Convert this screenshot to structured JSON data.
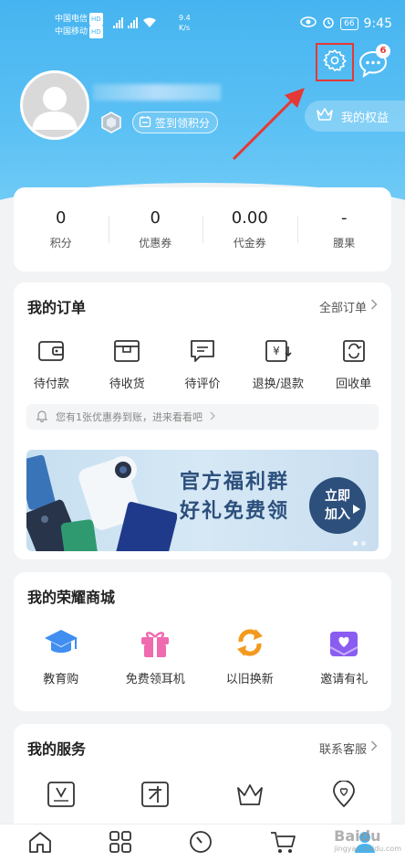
{
  "status": {
    "carrier1": "中国电信",
    "carrier2": "中国移动",
    "hd": "HD",
    "speed_value": "9.4",
    "speed_unit": "K/s",
    "battery": "66",
    "time": "9:45"
  },
  "header": {
    "message_badge": "6",
    "checkin_label": "签到领积分",
    "rights_label": "我的权益"
  },
  "stats": [
    {
      "value": "0",
      "label": "积分"
    },
    {
      "value": "0",
      "label": "优惠券"
    },
    {
      "value": "0.00",
      "label": "代金券"
    },
    {
      "value": "-",
      "label": "腰果"
    }
  ],
  "orders": {
    "title": "我的订单",
    "all_label": "全部订单",
    "items": [
      {
        "label": "待付款",
        "icon": "wallet-icon"
      },
      {
        "label": "待收货",
        "icon": "package-icon"
      },
      {
        "label": "待评价",
        "icon": "comment-icon"
      },
      {
        "label": "退换/退款",
        "icon": "refund-icon"
      },
      {
        "label": "回收单",
        "icon": "recycle-icon"
      }
    ],
    "notice": "您有1张优惠券到账，进来看看吧",
    "banner": {
      "line1": "官方福利群",
      "line2": "好礼免费领",
      "button_line1": "立即",
      "button_line2": "加入"
    }
  },
  "mall": {
    "title": "我的荣耀商城",
    "items": [
      {
        "label": "教育购",
        "icon": "graduation-cap-icon",
        "color": "#3f8ef0"
      },
      {
        "label": "免费领耳机",
        "icon": "gift-icon",
        "color": "#f06ab0"
      },
      {
        "label": "以旧换新",
        "icon": "exchange-icon",
        "color": "#f39a1e"
      },
      {
        "label": "邀请有礼",
        "icon": "invite-heart-icon",
        "color": "#8b5cf0"
      }
    ]
  },
  "services": {
    "title": "我的服务",
    "link_label": "联系客服",
    "items": [
      {
        "icon": "video-membership-icon"
      },
      {
        "icon": "talent-icon"
      },
      {
        "icon": "crown-icon"
      },
      {
        "icon": "location-heart-icon"
      }
    ]
  },
  "tabbar": {
    "items": [
      "home-tab-icon",
      "category-tab-icon",
      "discover-tab-icon",
      "cart-tab-icon",
      "me-tab-icon"
    ]
  },
  "watermark": {
    "text": "Baidu",
    "sub": "jingyan.baidu.com"
  },
  "colors": {
    "accent": "#46b4f0",
    "highlight": "#e53935"
  }
}
